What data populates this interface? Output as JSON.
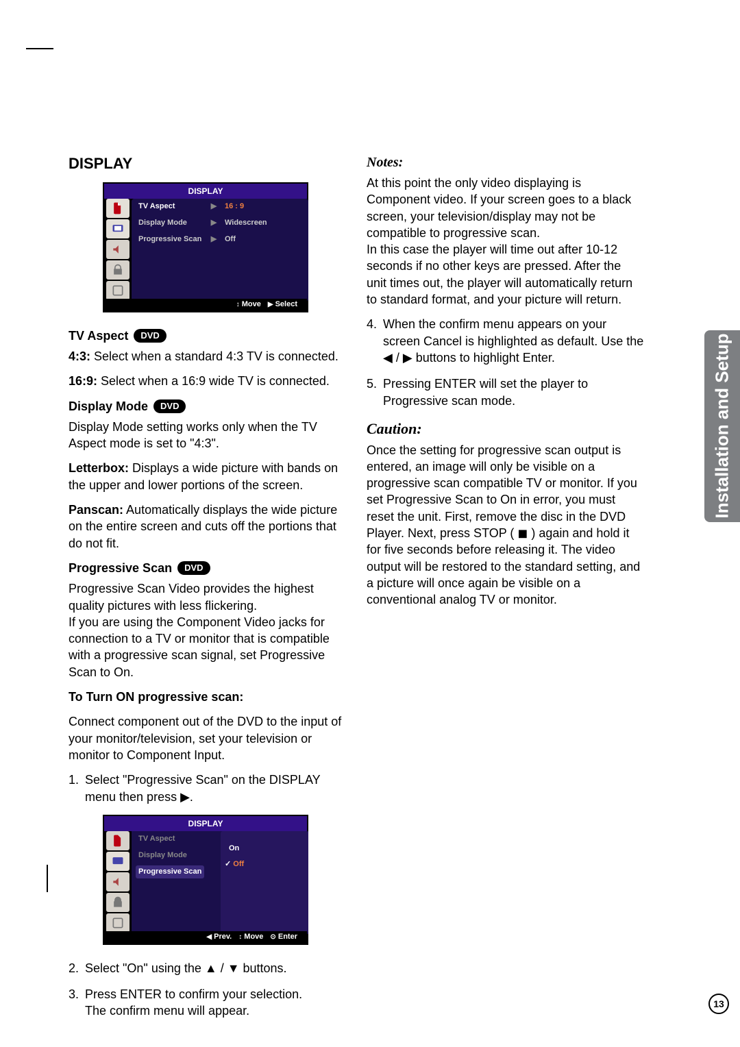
{
  "sideTab": "Installation and Setup",
  "pageNumber": "13",
  "headings": {
    "display": "DISPLAY",
    "tvAspect": "TV Aspect",
    "displayMode": "Display Mode",
    "progressive": "Progressive Scan",
    "turnOn": "To Turn ON progressive scan:",
    "notes": "Notes:",
    "caution": "Caution:"
  },
  "badges": {
    "dvd": "DVD"
  },
  "osd1": {
    "title": "DISPLAY",
    "rows": [
      {
        "label": "TV Aspect",
        "arrow": "▶",
        "value": "16 : 9",
        "hl": true
      },
      {
        "label": "Display Mode",
        "arrow": "▶",
        "value": "Widescreen",
        "hl": false
      },
      {
        "label": "Progressive Scan",
        "arrow": "▶",
        "value": "Off",
        "hl": false
      }
    ],
    "footer": [
      {
        "icon": "↕",
        "text": "Move"
      },
      {
        "icon": "▶",
        "text": "Select"
      }
    ]
  },
  "osd2": {
    "title": "DISPLAY",
    "rows": [
      {
        "label": "TV Aspect"
      },
      {
        "label": "Display Mode"
      },
      {
        "label": "Progressive Scan",
        "hl": true
      }
    ],
    "sub": {
      "on": "On",
      "off": "Off"
    },
    "footer": [
      {
        "icon": "◀",
        "text": "Prev."
      },
      {
        "icon": "↕",
        "text": "Move"
      },
      {
        "icon": "⊙",
        "text": "Enter"
      }
    ]
  },
  "body": {
    "p43_bold": "4:3:",
    "p43_rest": " Select when a standard 4:3 TV is connected.",
    "p169_bold": "16:9:",
    "p169_rest": " Select when a 16:9 wide TV is connected.",
    "dispMode_p": "Display Mode setting works only when the TV Aspect mode is set to \"4:3\".",
    "letter_bold": "Letterbox:",
    "letter_rest": " Displays a wide picture with bands on the upper and lower portions of the screen.",
    "pan_bold": "Panscan:",
    "pan_rest": " Automatically displays the wide picture on the entire screen and cuts off the portions that do not fit.",
    "prog_p1": "Progressive Scan Video provides the highest quality pictures with less flickering.",
    "prog_p2": "If you are using the Component Video jacks for connection to a TV or monitor that is compatible with a progressive scan signal, set Progressive Scan to On.",
    "conn_p": "Connect component out of the DVD to the input of your monitor/television, set your television or monitor to Component Input.",
    "step1": "Select \"Progressive Scan\" on the DISPLAY menu then press ▶.",
    "step2": "Select \"On\" using the ▲ / ▼ buttons.",
    "step3a": "Press ENTER to confirm your selection.",
    "step3b": "The confirm menu will appear.",
    "notes_p1": "At this point the only video displaying is Component video. If your screen goes to a black screen, your television/display may not be compatible to progressive scan.",
    "notes_p2": "In this case the player will time out after 10-12 seconds if no other keys are pressed. After the unit times out, the player will automatically return to standard format, and your picture will return.",
    "step4": "When the confirm menu appears on your screen Cancel is highlighted as default. Use the ◀ / ▶ buttons to highlight Enter.",
    "step5": "Pressing ENTER will set the player to Progressive scan mode.",
    "caution_p": "Once the setting for progressive scan output is entered, an image will only be visible on a progressive scan compatible TV or monitor. If you set Progressive Scan to On in error, you must reset the unit. First, remove the disc in the DVD Player. Next, press STOP ( ◼ ) again and hold it for five seconds before releasing it. The video output will be restored to the standard setting, and a picture will once again be visible on a conventional analog TV or monitor."
  }
}
